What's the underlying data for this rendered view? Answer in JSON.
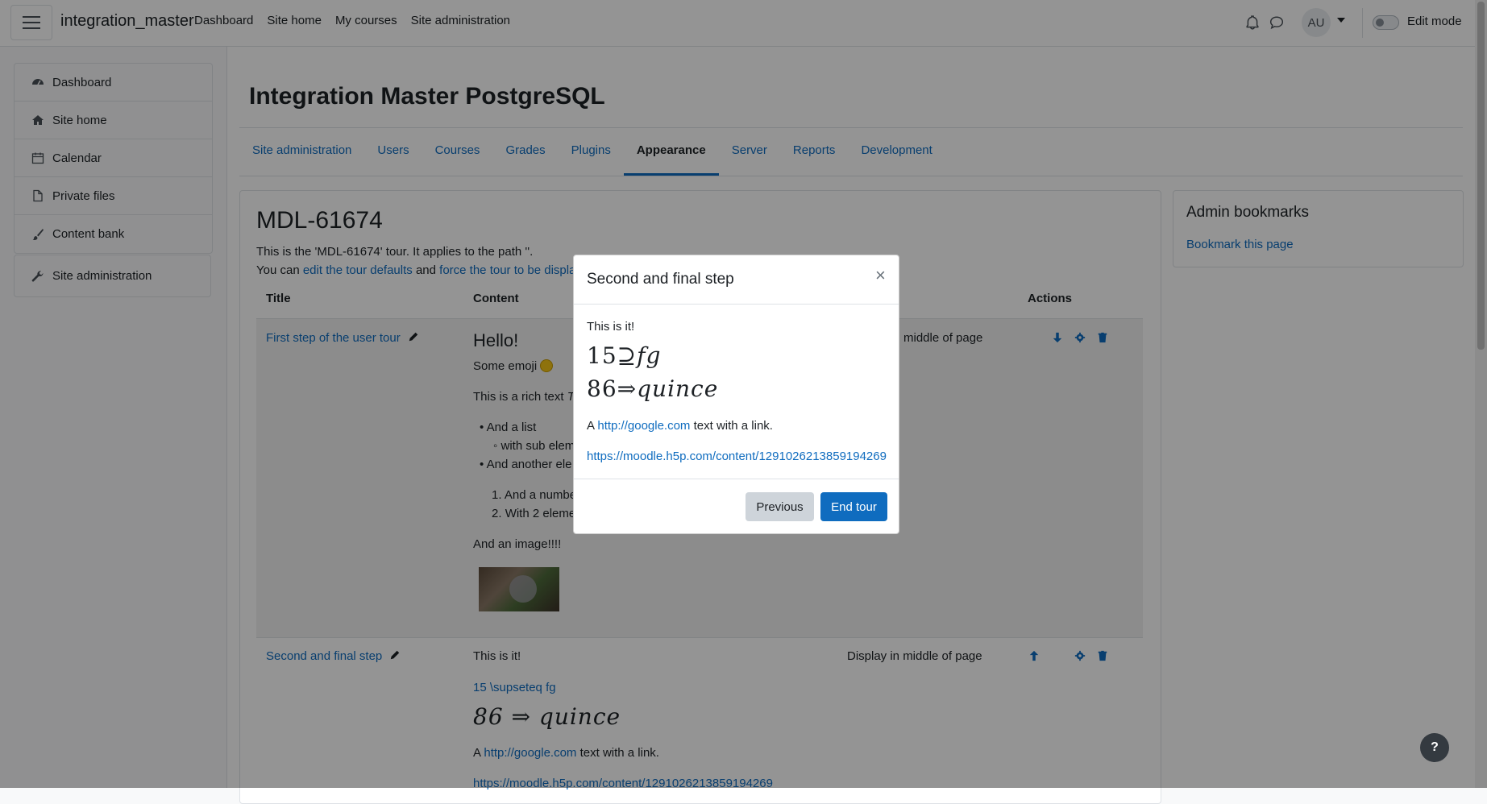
{
  "navbar": {
    "brand": "integration_master",
    "links": [
      "Dashboard",
      "Site home",
      "My courses",
      "Site administration"
    ],
    "avatar_initials": "AU",
    "edit_mode_label": "Edit mode"
  },
  "drawer": {
    "items": [
      {
        "label": "Dashboard",
        "icon": "dashboard-icon"
      },
      {
        "label": "Site home",
        "icon": "home-icon"
      },
      {
        "label": "Calendar",
        "icon": "calendar-icon"
      },
      {
        "label": "Private files",
        "icon": "file-icon"
      },
      {
        "label": "Content bank",
        "icon": "brush-icon"
      }
    ],
    "admin_label": "Site administration"
  },
  "page": {
    "title": "Integration Master PostgreSQL",
    "tabs": [
      "Site administration",
      "Users",
      "Courses",
      "Grades",
      "Plugins",
      "Appearance",
      "Server",
      "Reports",
      "Development"
    ],
    "active_tab": "Appearance"
  },
  "tour": {
    "name": "MDL-61674",
    "desc1": "This is the 'MDL-61674' tour. It applies to the path ''.",
    "desc2_prefix": "You can ",
    "desc2_link1": "edit the tour defaults",
    "desc2_mid": " and ",
    "desc2_link2": "force the tour to be displa",
    "table_headers": {
      "title": "Title",
      "content": "Content",
      "actions": "Actions"
    },
    "step1": {
      "title": "First step of the user tour",
      "hello": "Hello!",
      "emoji_text": "Some emoji",
      "rich_text": "This is a rich text ",
      "rich_text_italic": "T",
      "list_item1": "And a list",
      "sub_item": "with sub elem",
      "list_item2": "And another ele",
      "num_item1": "And a numbe",
      "num_item2": "With 2 eleme",
      "image_text": "And an image!!!!",
      "placement": "middle of page"
    },
    "step2": {
      "title": "Second and final step",
      "content": "This is it!",
      "broken_img_alt": "15 \\supseteq fg",
      "math": "86 ⇒ quince",
      "link_prefix": "A ",
      "link": "http://google.com",
      "link_suffix": " text with a link.",
      "h5p": "https://moodle.h5p.com/content/1291026213859194269",
      "placement": "Display in middle of page"
    }
  },
  "bookmarks": {
    "title": "Admin bookmarks",
    "link": "Bookmark this page"
  },
  "modal": {
    "title": "Second and final step",
    "close": "×",
    "text": "This is it!",
    "math1_num": "15",
    "math1_op": "⊇",
    "math1_var": "fg",
    "math2_num": "86",
    "math2_op": "⇒",
    "math2_var": "quince",
    "link_prefix": "A ",
    "link": "http://google.com",
    "link_suffix": " text with a link.",
    "h5p": "https://moodle.h5p.com/content/1291026213859194269",
    "prev_label": "Previous",
    "end_label": "End tour"
  },
  "help_label": "?"
}
